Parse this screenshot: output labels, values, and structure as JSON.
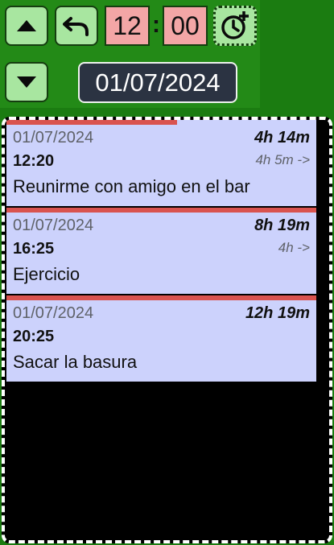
{
  "controls": {
    "hour": "12",
    "separator": ":",
    "minute": "00",
    "date": "01/07/2024",
    "up_icon": "triangle-up-icon",
    "down_icon": "triangle-down-icon",
    "undo_icon": "undo-arrow-icon",
    "alarm_icon": "alarm-clock-plus-icon"
  },
  "events": [
    {
      "date": "01/07/2024",
      "time": "12:20",
      "total": "4h 14m",
      "diff": "4h 5m ->",
      "title": "Reunirme con amigo en el bar",
      "progress": 0.55
    },
    {
      "date": "01/07/2024",
      "time": "16:25",
      "total": "8h 19m",
      "diff": "4h  ->",
      "title": "Ejercicio",
      "progress": 1.0
    },
    {
      "date": "01/07/2024",
      "time": "20:25",
      "total": "12h 19m",
      "diff": "",
      "title": "Sacar la basura",
      "progress": 1.0
    }
  ],
  "colors": {
    "panel_bg": "#238a17",
    "button_bg": "#a8e6a0",
    "time_bg": "#f3a6a6",
    "date_bg": "#2b3342",
    "card_bg": "#ccd2fc",
    "progress_bar": "#d9534f"
  }
}
